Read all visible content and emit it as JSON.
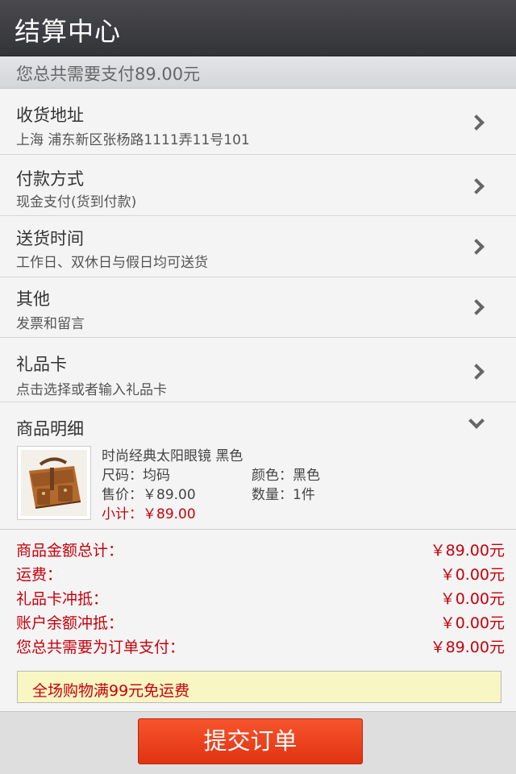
{
  "header": {
    "title": "结算中心"
  },
  "total_bar": {
    "text": "您总共需要支付89.00元"
  },
  "sections": [
    {
      "title": "收货地址",
      "subtitle": "上海 浦东新区张杨路1111弄11号101"
    },
    {
      "title": "付款方式",
      "subtitle": "现金支付(货到付款)"
    },
    {
      "title": "送货时间",
      "subtitle": "工作日、双休日与假日均可送货"
    },
    {
      "title": "其他",
      "subtitle": "发票和留言"
    },
    {
      "title": "礼品卡",
      "subtitle": "点击选择或者输入礼品卡"
    }
  ],
  "details": {
    "title": "商品明细",
    "product": {
      "name": "时尚经典太阳眼镜 黑色",
      "size": "尺码：均码",
      "color": "颜色：黑色",
      "price": "售价：￥89.00",
      "quantity": "数量：1件",
      "subtotal": "小计：￥89.00"
    }
  },
  "summary": [
    {
      "label": "商品金额总计：",
      "value": "￥89.00元"
    },
    {
      "label": "运费：",
      "value": "￥0.00元"
    },
    {
      "label": "礼品卡冲抵：",
      "value": "￥0.00元"
    },
    {
      "label": "账户余额冲抵：",
      "value": "￥0.00元"
    },
    {
      "label": "您总共需要为订单支付：",
      "value": "￥89.00元"
    }
  ],
  "notice": {
    "text": "全场购物满99元免运费"
  },
  "submit": {
    "label": "提交订单"
  },
  "icons": {
    "section_arrow": "chevron-right-icon",
    "details_toggle": "chevron-down-icon",
    "product_image": "bag-image"
  },
  "colors": {
    "accent_red": "#c7000b",
    "button": "#e8401a",
    "notice_bg": "#f8f6c3",
    "header_bg": "#3a3b3f"
  }
}
